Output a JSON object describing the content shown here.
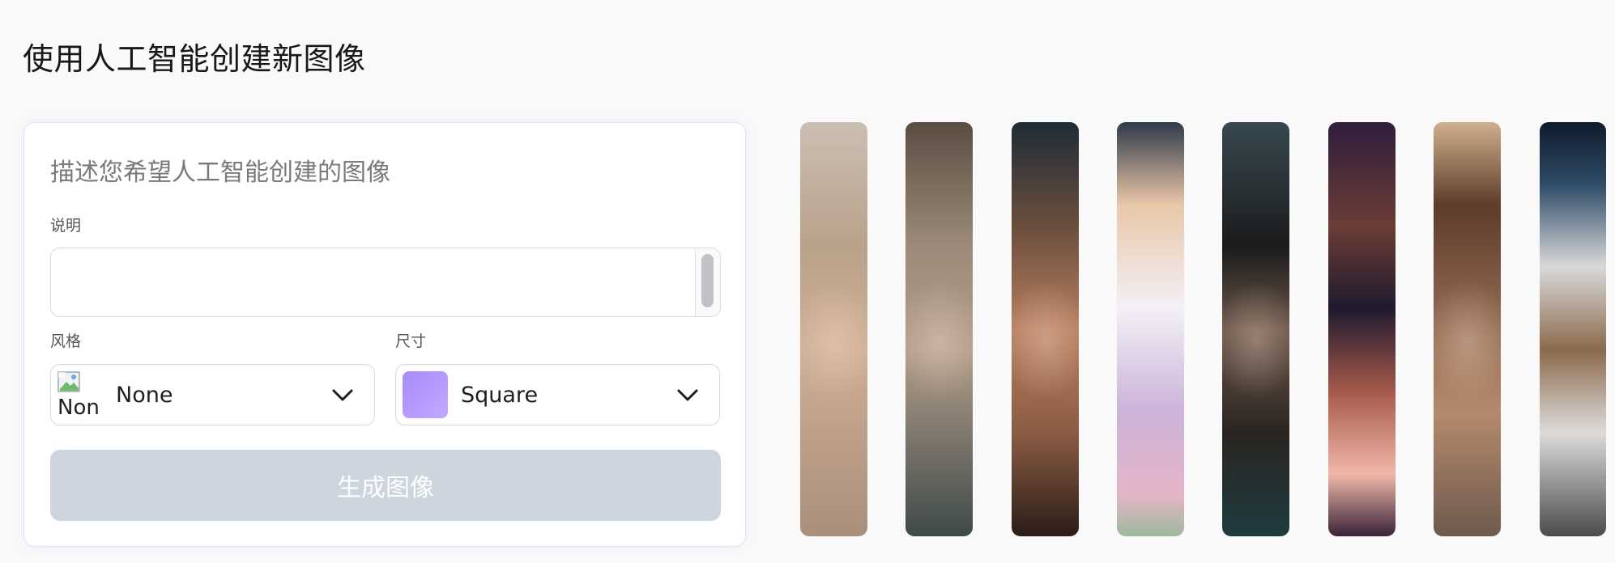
{
  "page": {
    "title": "使用人工智能创建新图像"
  },
  "form": {
    "heading": "描述您希望人工智能创建的图像",
    "description_label": "说明",
    "description_value": "",
    "style_label": "风格",
    "style_value": "None",
    "style_image_alt": "Non",
    "size_label": "尺寸",
    "size_value": "Square",
    "generate_button": "生成图像"
  },
  "gallery": {
    "count": 8
  },
  "colors": {
    "page_background": "#f9f9fa",
    "card_border": "#e3e1fb",
    "button_disabled": "#cdd5df",
    "size_swatch": "#a78bfa"
  },
  "icons": {
    "style_dropdown": "chevron-down-icon",
    "size_dropdown": "chevron-down-icon",
    "style_thumbnail": "broken-image-icon"
  }
}
